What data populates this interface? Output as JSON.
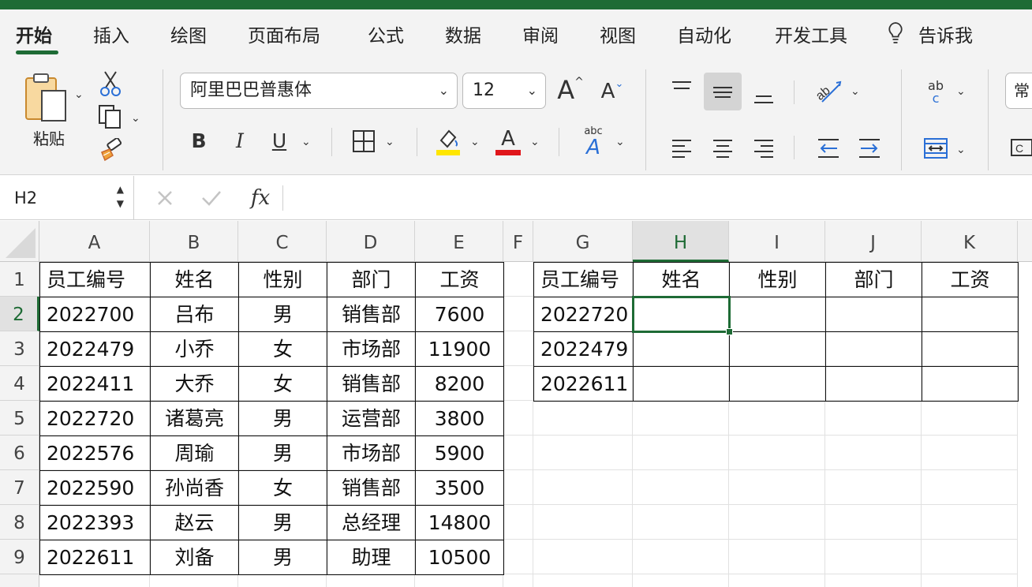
{
  "tabs": [
    {
      "label": "开始",
      "active": true
    },
    {
      "label": "插入"
    },
    {
      "label": "绘图"
    },
    {
      "label": "页面布局"
    },
    {
      "label": "公式"
    },
    {
      "label": "数据"
    },
    {
      "label": "审阅"
    },
    {
      "label": "视图"
    },
    {
      "label": "自动化"
    },
    {
      "label": "开发工具"
    },
    {
      "label": "告诉我"
    }
  ],
  "ribbon": {
    "paste_label": "粘贴",
    "font_name": "阿里巴巴普惠体",
    "font_size": "12",
    "bold": "B",
    "italic": "I",
    "underline": "U",
    "font_color_letter": "A",
    "grow_letter": "A",
    "shrink_letter": "A",
    "wrap_abc": "abc",
    "wrap_ab": "ab",
    "wrap_c": "c",
    "number_format_partial": "常",
    "highlight_color": "#ffe600",
    "font_color": "#e0161b"
  },
  "formula_bar": {
    "cell_ref": "H2",
    "fx": "fx",
    "value": ""
  },
  "sheet": {
    "columns": [
      "A",
      "B",
      "C",
      "D",
      "E",
      "F",
      "G",
      "H",
      "I",
      "J",
      "K"
    ],
    "selected_column": "H",
    "rows": [
      "1",
      "2",
      "3",
      "4",
      "5",
      "6",
      "7",
      "8",
      "9"
    ],
    "selected_row": "2",
    "selected_cell": "H2",
    "left_table": {
      "headers": [
        "员工编号",
        "姓名",
        "性别",
        "部门",
        "工资"
      ],
      "rows": [
        [
          "2022700",
          "吕布",
          "男",
          "销售部",
          "7600"
        ],
        [
          "2022479",
          "小乔",
          "女",
          "市场部",
          "11900"
        ],
        [
          "2022411",
          "大乔",
          "女",
          "销售部",
          "8200"
        ],
        [
          "2022720",
          "诸葛亮",
          "男",
          "运营部",
          "3800"
        ],
        [
          "2022576",
          "周瑜",
          "男",
          "市场部",
          "5900"
        ],
        [
          "2022590",
          "孙尚香",
          "女",
          "销售部",
          "3500"
        ],
        [
          "2022393",
          "赵云",
          "男",
          "总经理",
          "14800"
        ],
        [
          "2022611",
          "刘备",
          "男",
          "助理",
          "10500"
        ]
      ]
    },
    "right_table": {
      "headers": [
        "员工编号",
        "姓名",
        "性别",
        "部门",
        "工资"
      ],
      "rows": [
        [
          "2022720",
          "",
          "",
          "",
          ""
        ],
        [
          "2022479",
          "",
          "",
          "",
          ""
        ],
        [
          "2022611",
          "",
          "",
          "",
          ""
        ]
      ]
    }
  },
  "colors": {
    "accent": "#1e6b35",
    "ribbon_bg": "#f3f3f3"
  }
}
